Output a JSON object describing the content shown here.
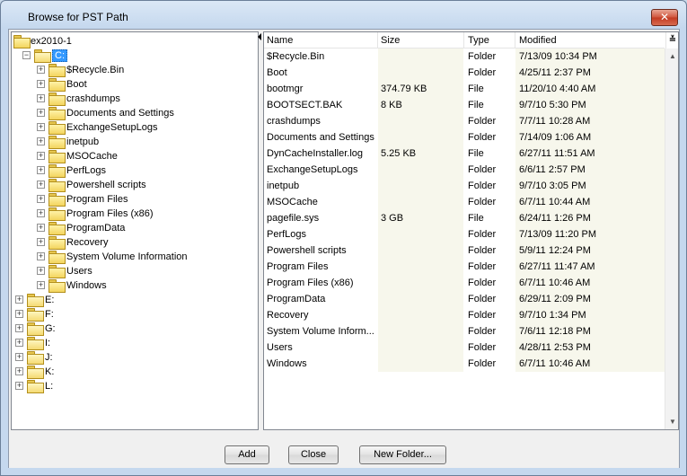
{
  "window": {
    "title": "Browse for PST Path"
  },
  "tree": {
    "root": "ex2010-1",
    "selected_drive": "C:",
    "c_children": [
      "$Recycle.Bin",
      "Boot",
      "crashdumps",
      "Documents and Settings",
      "ExchangeSetupLogs",
      "inetpub",
      "MSOCache",
      "PerfLogs",
      "Powershell scripts",
      "Program Files",
      "Program Files (x86)",
      "ProgramData",
      "Recovery",
      "System Volume Information",
      "Users",
      "Windows"
    ],
    "other_drives": [
      "E:",
      "F:",
      "G:",
      "I:",
      "J:",
      "K:",
      "L:"
    ]
  },
  "list": {
    "columns": {
      "name": "Name",
      "size": "Size",
      "type": "Type",
      "modified": "Modified"
    },
    "rows": [
      {
        "name": "$Recycle.Bin",
        "size": "",
        "type": "Folder",
        "modified": "7/13/09 10:34 PM"
      },
      {
        "name": "Boot",
        "size": "",
        "type": "Folder",
        "modified": "4/25/11 2:37 PM"
      },
      {
        "name": "bootmgr",
        "size": "374.79 KB",
        "type": "File",
        "modified": "11/20/10 4:40 AM"
      },
      {
        "name": "BOOTSECT.BAK",
        "size": "8 KB",
        "type": "File",
        "modified": "9/7/10 5:30 PM"
      },
      {
        "name": "crashdumps",
        "size": "",
        "type": "Folder",
        "modified": "7/7/11 10:28 AM"
      },
      {
        "name": "Documents and Settings",
        "size": "",
        "type": "Folder",
        "modified": "7/14/09 1:06 AM"
      },
      {
        "name": "DynCacheInstaller.log",
        "size": "5.25 KB",
        "type": "File",
        "modified": "6/27/11 11:51 AM"
      },
      {
        "name": "ExchangeSetupLogs",
        "size": "",
        "type": "Folder",
        "modified": "6/6/11 2:57 PM"
      },
      {
        "name": "inetpub",
        "size": "",
        "type": "Folder",
        "modified": "9/7/10 3:05 PM"
      },
      {
        "name": "MSOCache",
        "size": "",
        "type": "Folder",
        "modified": "6/7/11 10:44 AM"
      },
      {
        "name": "pagefile.sys",
        "size": "3 GB",
        "type": "File",
        "modified": "6/24/11 1:26 PM"
      },
      {
        "name": "PerfLogs",
        "size": "",
        "type": "Folder",
        "modified": "7/13/09 11:20 PM"
      },
      {
        "name": "Powershell scripts",
        "size": "",
        "type": "Folder",
        "modified": "5/9/11 12:24 PM"
      },
      {
        "name": "Program Files",
        "size": "",
        "type": "Folder",
        "modified": "6/27/11 11:47 AM"
      },
      {
        "name": "Program Files (x86)",
        "size": "",
        "type": "Folder",
        "modified": "6/7/11 10:46 AM"
      },
      {
        "name": "ProgramData",
        "size": "",
        "type": "Folder",
        "modified": "6/29/11 2:09 PM"
      },
      {
        "name": "Recovery",
        "size": "",
        "type": "Folder",
        "modified": "9/7/10 1:34 PM"
      },
      {
        "name": "System Volume Inform...",
        "size": "",
        "type": "Folder",
        "modified": "7/6/11 12:18 PM"
      },
      {
        "name": "Users",
        "size": "",
        "type": "Folder",
        "modified": "4/28/11 2:53 PM"
      },
      {
        "name": "Windows",
        "size": "",
        "type": "Folder",
        "modified": "6/7/11 10:46 AM"
      }
    ]
  },
  "buttons": {
    "add": "Add",
    "close": "Close",
    "new_folder": "New Folder..."
  },
  "icons": {
    "close": "close-icon",
    "folder": "folder-icon",
    "expander": "plus-expander-icon",
    "chevron": "double-chevron-down-icon",
    "scroll_up": "scroll-up-arrow-icon",
    "scroll_down": "scroll-down-arrow-icon"
  },
  "colors": {
    "selection": "#3399ff",
    "row_band": "#f7f7ec",
    "title_bar": "#c5d8ee"
  }
}
